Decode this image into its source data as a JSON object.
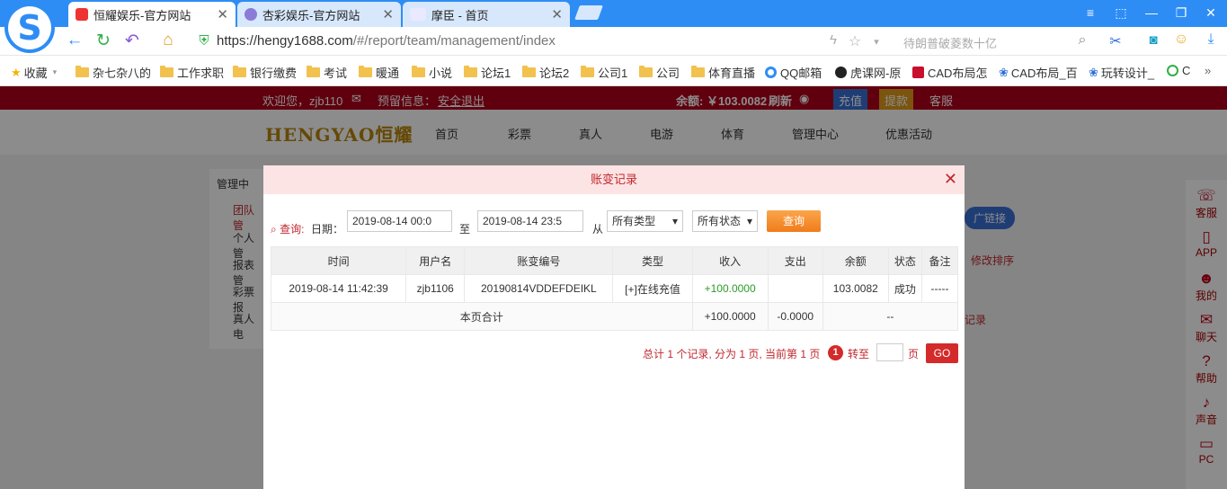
{
  "browser": {
    "tabs": [
      {
        "title": "恒耀娱乐-官方网站",
        "active": true
      },
      {
        "title": "杏彩娱乐-官方网站",
        "active": false
      },
      {
        "title": "摩臣 - 首页",
        "active": false
      }
    ],
    "url_host": "https://hengy1688.com",
    "url_path": "/#/report/team/management/index",
    "search_placeholder": "待朗普破菱数十亿",
    "bookmarks": [
      "收藏",
      "杂七杂八的",
      "工作求职",
      "银行缴费",
      "考试",
      "暖通",
      "小说",
      "论坛1",
      "论坛2",
      "公司1",
      "公司",
      "体育直播",
      "QQ邮箱",
      "虎课网-原",
      "CAD布局怎",
      "CAD布局_百",
      "玩转设计_",
      "C"
    ]
  },
  "site": {
    "welcome": "欢迎您，zjb110",
    "warning_label": "预留信息：",
    "logout": "安全退出",
    "balance": "余额: ￥103.0082",
    "refresh": "刷新",
    "recharge": "充值",
    "withdraw": "提款",
    "service": "客服",
    "logo_text": "HENGYAO恒耀",
    "menu": [
      "首页",
      "彩票",
      "真人",
      "电游",
      "体育",
      "管理中心",
      "优惠活动"
    ],
    "side_items": [
      "管理中",
      "团队管",
      "个人管",
      "报表管",
      "彩票报",
      "真人电"
    ],
    "right_bar": [
      "客服",
      "APP",
      "我的",
      "聊天",
      "帮助",
      "声音",
      "PC"
    ],
    "behind_link": "广链接",
    "behind_sort": "修改排序",
    "behind_record": "记录"
  },
  "modal": {
    "title": "账变记录",
    "query_label": "查询:",
    "date_label": "日期：",
    "date_from": "2019-08-14 00:0",
    "to_label": "至",
    "date_to": "2019-08-14 23:5",
    "from_label": "从",
    "type_select": "所有类型",
    "status_select": "所有状态",
    "query_button": "查询",
    "columns": [
      "时间",
      "用户名",
      "账变编号",
      "类型",
      "收入",
      "支出",
      "余额",
      "状态",
      "备注"
    ],
    "rows": [
      {
        "time": "2019-08-14 11:42:39",
        "user": "zjb1106",
        "id": "20190814VDDEFDEIKL",
        "type": "[+]在线充值",
        "income": "+100.0000",
        "expense": "",
        "balance": "103.0082",
        "status": "成功",
        "note": "-----"
      }
    ],
    "subtotal_label": "本页合计",
    "subtotal_income": "+100.0000",
    "subtotal_expense": "-0.0000",
    "subtotal_rest": "--",
    "pager_text": "总计 1 个记录, 分为 1 页, 当前第 1 页",
    "current_page": "1",
    "goto_label": "转至",
    "page_unit": "页",
    "go_button": "GO"
  },
  "colors": {
    "accent": "#c1272d",
    "browser_blue": "#2e8df5",
    "topbar": "#b0001a"
  }
}
